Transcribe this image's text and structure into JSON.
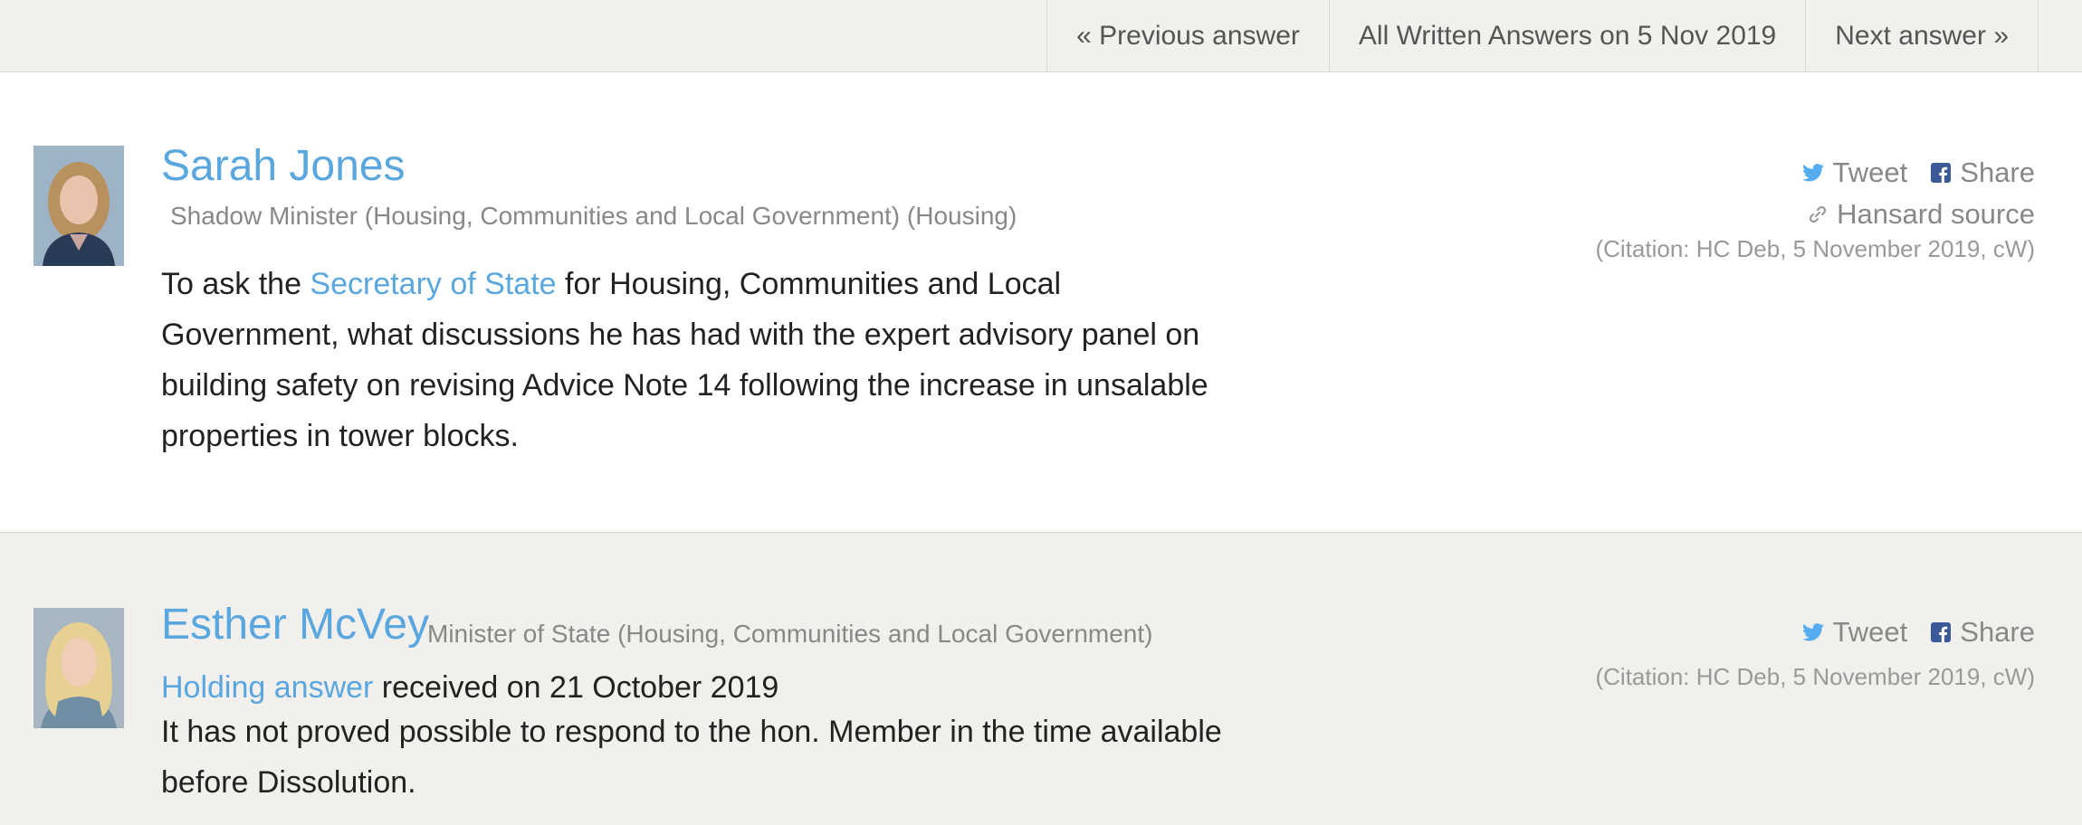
{
  "nav": {
    "previous": "« Previous answer",
    "all": "All Written Answers on 5 Nov 2019",
    "next": "Next answer »"
  },
  "question": {
    "member_name": "Sarah Jones",
    "member_role": "Shadow Minister (Housing, Communities and Local Government) (Housing)",
    "text_before": "To ask the ",
    "link_text": "Secretary of State",
    "text_after": " for Housing, Communities and Local Government, what discussions he has had with the expert advisory panel on building safety on revising Advice Note 14 following the increase in unsalable properties in tower blocks.",
    "tweet": "Tweet",
    "share": "Share",
    "hansard": "Hansard source",
    "citation": "(Citation: HC Deb, 5 November 2019, cW)"
  },
  "answer": {
    "member_name": "Esther McVey",
    "member_role": "Minister of State (Housing, Communities and Local Government)",
    "holding_link": "Holding answer",
    "holding_rest": " received on 21 October 2019",
    "text": "It has not proved possible to respond to the hon. Member in the time available before Dissolution.",
    "tweet": "Tweet",
    "share": "Share",
    "citation": "(Citation: HC Deb, 5 November 2019, cW)"
  },
  "colors": {
    "link": "#5aa6df",
    "background": "#f1f0ec",
    "twitter": "#55acee",
    "facebook": "#3b5998"
  },
  "icons": [
    "twitter-icon",
    "facebook-icon",
    "link-icon"
  ]
}
